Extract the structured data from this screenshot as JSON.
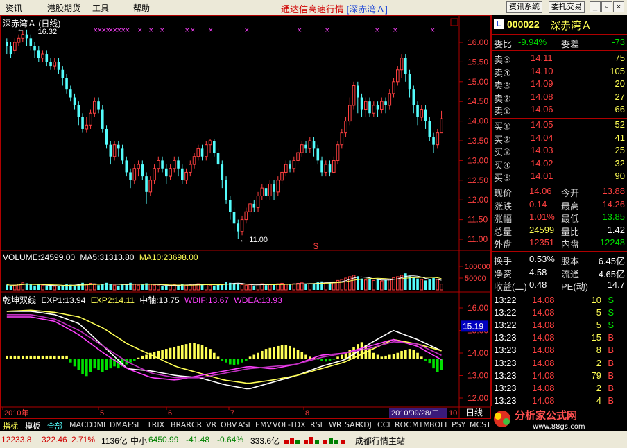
{
  "menu": {
    "items": [
      "资讯",
      "港股期货",
      "工具",
      "帮助"
    ]
  },
  "title": {
    "main": "通达信高速行情",
    "stock": "[深赤湾Ａ]"
  },
  "top_buttons": {
    "info": "资讯系统",
    "trade": "委托交易"
  },
  "chart_header": {
    "name": "深赤湾Ａ (日线)"
  },
  "price_axis": {
    "ticks": [
      "16.00",
      "15.50",
      "15.00",
      "14.50",
      "14.00",
      "13.50",
      "13.00",
      "12.50",
      "12.00",
      "11.50",
      "11.00"
    ]
  },
  "annotations": {
    "high": "16.32",
    "low": "11.00",
    "dollar": "$"
  },
  "volume_header": {
    "volume": "VOLUME:24599.00",
    "ma5": "MA5:31313.80",
    "ma10": "MA10:23698.00"
  },
  "volume_axis": {
    "ticks": [
      "100000",
      "50000"
    ]
  },
  "indicator_header": {
    "name": "乾坤双线",
    "exp1": "EXP1:13.94",
    "exp2": "EXP2:14.11",
    "axis": "中轴:13.75",
    "wdif": "WDIF:13.67",
    "wdea": "WDEA:13.93"
  },
  "indicator_axis": {
    "ticks": [
      "16.00",
      "15.00",
      "14.00",
      "13.00",
      "12.00"
    ],
    "current": "15.19"
  },
  "date_axis": {
    "labels": [
      "2010年",
      "5",
      "6",
      "7",
      "8"
    ],
    "cursor_date": "2010/09/28/二",
    "end_label": "10"
  },
  "period": "日线",
  "quote": {
    "code_badge": "L",
    "code": "000022",
    "name": "深赤湾Ａ",
    "ratio_label": "委比",
    "ratio": "-9.94%",
    "diff_label": "委差",
    "diff": "-73",
    "asks": [
      {
        "label": "卖⑤",
        "price": "14.11",
        "vol": "75"
      },
      {
        "label": "卖④",
        "price": "14.10",
        "vol": "105"
      },
      {
        "label": "卖③",
        "price": "14.09",
        "vol": "20"
      },
      {
        "label": "卖②",
        "price": "14.08",
        "vol": "27"
      },
      {
        "label": "卖①",
        "price": "14.06",
        "vol": "66"
      }
    ],
    "bids": [
      {
        "label": "买①",
        "price": "14.05",
        "vol": "52"
      },
      {
        "label": "买②",
        "price": "14.04",
        "vol": "41"
      },
      {
        "label": "买③",
        "price": "14.03",
        "vol": "25"
      },
      {
        "label": "买④",
        "price": "14.02",
        "vol": "32"
      },
      {
        "label": "买⑤",
        "price": "14.01",
        "vol": "90"
      }
    ],
    "stats": [
      {
        "l1": "现价",
        "v1": "14.06",
        "l2": "今开",
        "v2": "13.88"
      },
      {
        "l1": "涨跌",
        "v1": "0.14",
        "l2": "最高",
        "v2": "14.26"
      },
      {
        "l1": "涨幅",
        "v1": "1.01%",
        "l2": "最低",
        "v2": "13.85"
      },
      {
        "l1": "总量",
        "v1": "24599",
        "l2": "量比",
        "v2": "1.42"
      },
      {
        "l1": "外盘",
        "v1": "12351",
        "l2": "内盘",
        "v2": "12248"
      }
    ],
    "stats2": [
      {
        "l1": "换手",
        "v1": "0.53%",
        "l2": "股本",
        "v2": "6.45亿"
      },
      {
        "l1": "净资",
        "v1": "4.58",
        "l2": "流通",
        "v2": "4.65亿"
      },
      {
        "l1": "收益(二)",
        "v1": "0.48",
        "l2": "PE(动)",
        "v2": "14.7"
      }
    ],
    "ticks": [
      {
        "time": "13:22",
        "price": "14.08",
        "vol": "10",
        "side": "S"
      },
      {
        "time": "13:22",
        "price": "14.08",
        "vol": "5",
        "side": "S"
      },
      {
        "time": "13:22",
        "price": "14.08",
        "vol": "5",
        "side": "S"
      },
      {
        "time": "13:23",
        "price": "14.08",
        "vol": "15",
        "side": "B"
      },
      {
        "time": "13:23",
        "price": "14.08",
        "vol": "8",
        "side": "B"
      },
      {
        "time": "13:23",
        "price": "14.08",
        "vol": "2",
        "side": "B"
      },
      {
        "time": "13:23",
        "price": "14.08",
        "vol": "79",
        "side": "B"
      },
      {
        "time": "13:23",
        "price": "14.08",
        "vol": "2",
        "side": "B"
      },
      {
        "time": "13:23",
        "price": "14.08",
        "vol": "4",
        "side": "B"
      }
    ]
  },
  "tabs": [
    "指标",
    "模板",
    "全部",
    "MACD",
    "DMI",
    "DMA",
    "FSL",
    "TRIX",
    "BRAR",
    "CR",
    "VR",
    "OBV",
    "ASI",
    "EMV",
    "VOL-TDX",
    "RSI",
    "WR",
    "SAR",
    "KDJ",
    "CCI",
    "ROC",
    "MTM",
    "BOLL",
    "PSY",
    "MCST"
  ],
  "status": {
    "index1_val": "12233.8",
    "index1_chg": "322.46",
    "index1_pct": "2.71%",
    "index1_amt": "1136亿",
    "index2_name": "中小",
    "index2_val": "6450.99",
    "index2_chg": "-41.48",
    "index2_pct": "-0.64%",
    "index2_amt": "333.6亿",
    "server": "成都行情主站"
  },
  "logo": {
    "text": "分析家公式网",
    "url": "www.88gs.com"
  },
  "colors": {
    "up": "#ff4040",
    "down": "#54fcfc",
    "ma5": "#ffffff",
    "ma10": "#ffff55",
    "wdif": "#ff40ff",
    "green": "#00e000"
  }
}
